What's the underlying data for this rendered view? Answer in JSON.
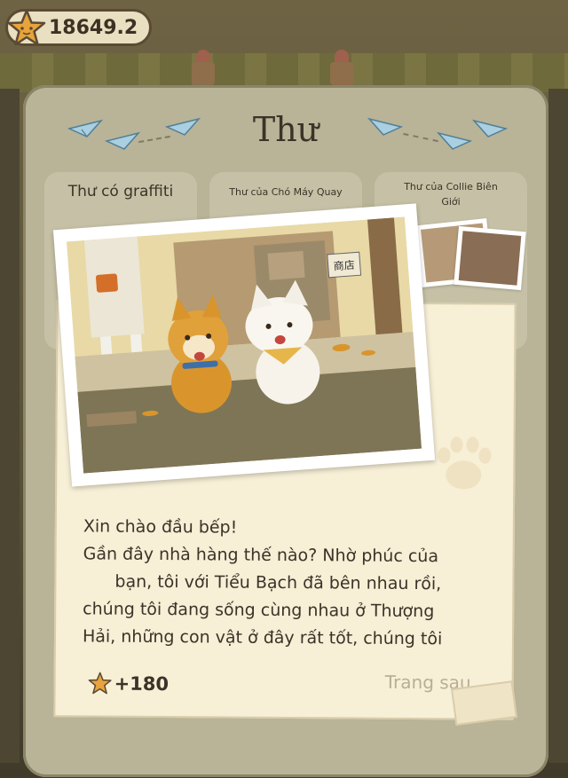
{
  "hud": {
    "coin_value": "18649.2",
    "coin_icon": "star-coin-icon"
  },
  "modal": {
    "title": "Thư",
    "tabs": [
      {
        "label": "Thư có graffiti"
      },
      {
        "label": "Thư của Chó Máy Quay"
      },
      {
        "label": "Thư của Collie Biên Giới"
      }
    ]
  },
  "letter": {
    "photo_sign_text": "商店",
    "lines": [
      "Xin chào đầu bếp!",
      "Gần đây nhà hàng thế nào? Nhờ phúc của",
      "bạn, tôi với Tiểu Bạch đã bên nhau rồi,",
      "chúng tôi đang sống cùng nhau ở Thượng",
      "Hải, những con vật ở đây rất tốt, chúng tôi"
    ],
    "reward_value": "+180",
    "reward_icon": "star-coin-icon",
    "next_page_label": "Trang sau"
  },
  "colors": {
    "modal_bg": "#b9b397",
    "paper": "#f7efd6",
    "text": "#3b3328",
    "next_page": "#b9ad96",
    "star": "#e8a33c"
  }
}
